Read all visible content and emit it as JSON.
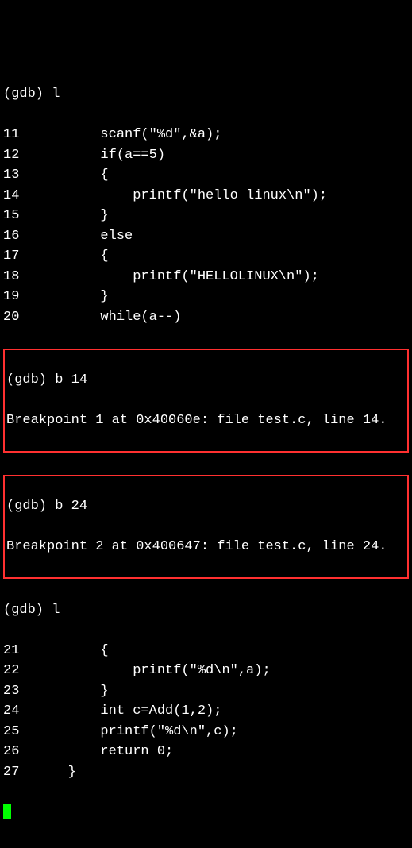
{
  "prompts": {
    "gdb_l_1": "(gdb) l",
    "gdb_b14": "(gdb) b 14",
    "gdb_b24": "(gdb) b 24",
    "gdb_l_2": "(gdb) l"
  },
  "listing1": [
    {
      "n": "11",
      "code": "scanf(\"%d\",&a);"
    },
    {
      "n": "12",
      "code": "if(a==5)"
    },
    {
      "n": "13",
      "code": "{"
    },
    {
      "n": "14",
      "code": "    printf(\"hello linux\\n\");"
    },
    {
      "n": "15",
      "code": "}"
    },
    {
      "n": "16",
      "code": "else"
    },
    {
      "n": "17",
      "code": "{"
    },
    {
      "n": "18",
      "code": "    printf(\"HELLOLINUX\\n\");"
    },
    {
      "n": "19",
      "code": "}"
    },
    {
      "n": "20",
      "code": "while(a--)"
    }
  ],
  "bp1": "Breakpoint 1 at 0x40060e: file test.c, line 14.",
  "bp2": "Breakpoint 2 at 0x400647: file test.c, line 24.",
  "listing2": [
    {
      "n": "21",
      "code": "{"
    },
    {
      "n": "22",
      "code": "    printf(\"%d\\n\",a);"
    },
    {
      "n": "23",
      "code": "}"
    },
    {
      "n": "24",
      "code": "int c=Add(1,2);"
    },
    {
      "n": "25",
      "code": "printf(\"%d\\n\",c);"
    },
    {
      "n": "26",
      "code": "return 0;"
    },
    {
      "n": "27",
      "code": "}",
      "outdent": true
    }
  ]
}
